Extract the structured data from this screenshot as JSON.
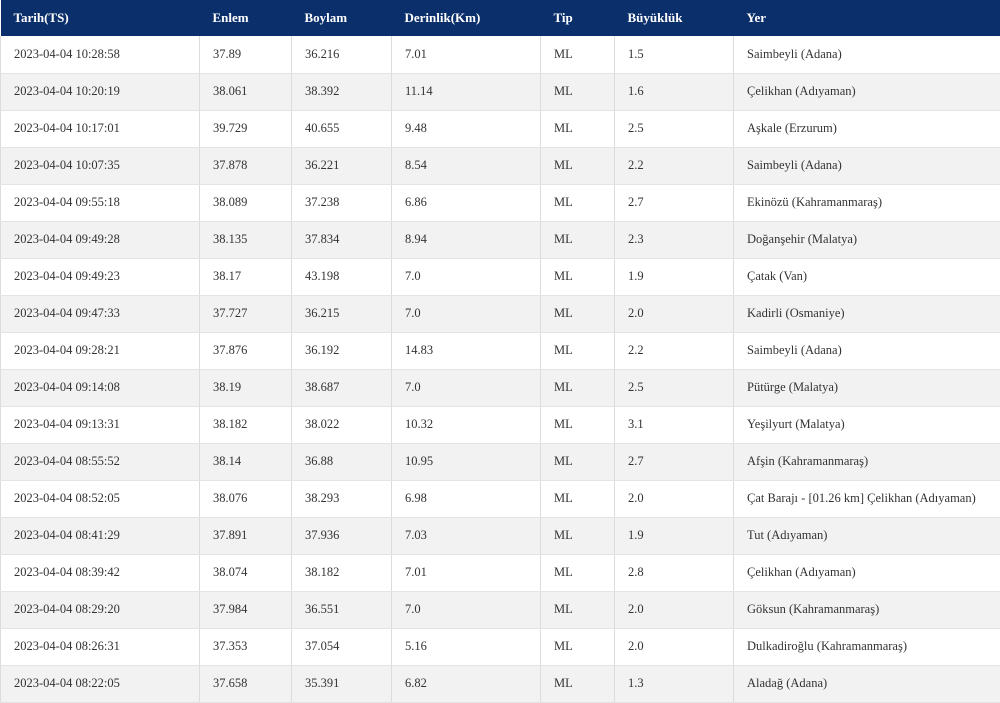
{
  "table": {
    "columns": [
      "Tarih(TS)",
      "Enlem",
      "Boylam",
      "Derinlik(Km)",
      "Tip",
      "Büyüklük",
      "Yer"
    ],
    "rows": [
      [
        "2023-04-04 10:28:58",
        "37.89",
        "36.216",
        "7.01",
        "ML",
        "1.5",
        "Saimbeyli (Adana)"
      ],
      [
        "2023-04-04 10:20:19",
        "38.061",
        "38.392",
        "11.14",
        "ML",
        "1.6",
        "Çelikhan (Adıyaman)"
      ],
      [
        "2023-04-04 10:17:01",
        "39.729",
        "40.655",
        "9.48",
        "ML",
        "2.5",
        "Aşkale (Erzurum)"
      ],
      [
        "2023-04-04 10:07:35",
        "37.878",
        "36.221",
        "8.54",
        "ML",
        "2.2",
        "Saimbeyli (Adana)"
      ],
      [
        "2023-04-04 09:55:18",
        "38.089",
        "37.238",
        "6.86",
        "ML",
        "2.7",
        "Ekinözü (Kahramanmaraş)"
      ],
      [
        "2023-04-04 09:49:28",
        "38.135",
        "37.834",
        "8.94",
        "ML",
        "2.3",
        "Doğanşehir (Malatya)"
      ],
      [
        "2023-04-04 09:49:23",
        "38.17",
        "43.198",
        "7.0",
        "ML",
        "1.9",
        "Çatak (Van)"
      ],
      [
        "2023-04-04 09:47:33",
        "37.727",
        "36.215",
        "7.0",
        "ML",
        "2.0",
        "Kadirli (Osmaniye)"
      ],
      [
        "2023-04-04 09:28:21",
        "37.876",
        "36.192",
        "14.83",
        "ML",
        "2.2",
        "Saimbeyli (Adana)"
      ],
      [
        "2023-04-04 09:14:08",
        "38.19",
        "38.687",
        "7.0",
        "ML",
        "2.5",
        "Pütürge (Malatya)"
      ],
      [
        "2023-04-04 09:13:31",
        "38.182",
        "38.022",
        "10.32",
        "ML",
        "3.1",
        "Yeşilyurt (Malatya)"
      ],
      [
        "2023-04-04 08:55:52",
        "38.14",
        "36.88",
        "10.95",
        "ML",
        "2.7",
        "Afşin (Kahramanmaraş)"
      ],
      [
        "2023-04-04 08:52:05",
        "38.076",
        "38.293",
        "6.98",
        "ML",
        "2.0",
        "Çat Barajı - [01.26 km] Çelikhan (Adıyaman)"
      ],
      [
        "2023-04-04 08:41:29",
        "37.891",
        "37.936",
        "7.03",
        "ML",
        "1.9",
        "Tut (Adıyaman)"
      ],
      [
        "2023-04-04 08:39:42",
        "38.074",
        "38.182",
        "7.01",
        "ML",
        "2.8",
        "Çelikhan (Adıyaman)"
      ],
      [
        "2023-04-04 08:29:20",
        "37.984",
        "36.551",
        "7.0",
        "ML",
        "2.0",
        "Göksun (Kahramanmaraş)"
      ],
      [
        "2023-04-04 08:26:31",
        "37.353",
        "37.054",
        "5.16",
        "ML",
        "2.0",
        "Dulkadiroğlu (Kahramanmaraş)"
      ],
      [
        "2023-04-04 08:22:05",
        "37.658",
        "35.391",
        "6.82",
        "ML",
        "1.3",
        "Aladağ (Adana)"
      ]
    ]
  }
}
